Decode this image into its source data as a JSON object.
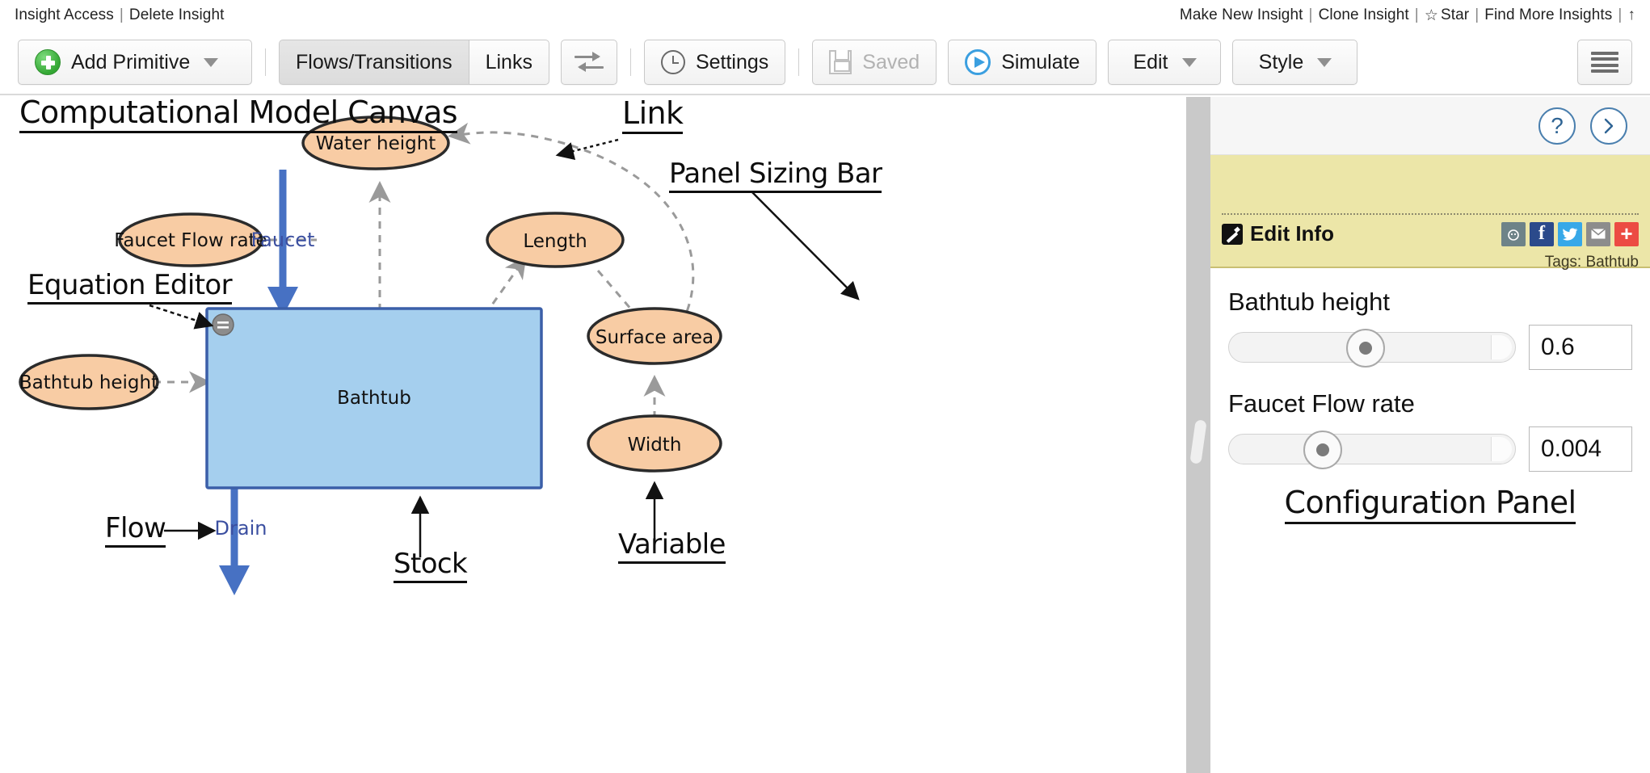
{
  "topbar": {
    "left": [
      {
        "label": "Insight Access"
      },
      {
        "label": "Delete Insight"
      }
    ],
    "right": [
      {
        "label": "Make New Insight"
      },
      {
        "label": "Clone Insight"
      },
      {
        "label": "Star",
        "icon": "star-icon"
      },
      {
        "label": "Find More Insights"
      },
      {
        "label": "↑",
        "icon": "arrow-up-icon"
      }
    ],
    "separator": "|"
  },
  "toolbar": {
    "add_primitive": "Add Primitive",
    "flows_transitions": "Flows/Transitions",
    "links": "Links",
    "swap_icon": "swap-arrows-icon",
    "settings": "Settings",
    "saved": "Saved",
    "simulate": "Simulate",
    "edit": "Edit",
    "style": "Style",
    "menu_icon": "hamburger-menu-icon"
  },
  "canvas": {
    "annotations": [
      {
        "id": "canvas-title",
        "text": "Computational Model Canvas"
      },
      {
        "id": "link-anno",
        "text": "Link"
      },
      {
        "id": "panel-sizing-anno",
        "text": "Panel Sizing Bar"
      },
      {
        "id": "equation-editor-anno",
        "text": "Equation Editor"
      },
      {
        "id": "flow-anno",
        "text": "Flow"
      },
      {
        "id": "stock-anno",
        "text": "Stock"
      },
      {
        "id": "variable-anno",
        "text": "Variable"
      }
    ],
    "nodes": [
      {
        "id": "water-height",
        "label": "Water height",
        "type": "variable"
      },
      {
        "id": "faucet-flow-rate",
        "label": "Faucet Flow rate",
        "type": "variable"
      },
      {
        "id": "bathtub-height",
        "label": "Bathtub height",
        "type": "variable"
      },
      {
        "id": "length",
        "label": "Length",
        "type": "variable"
      },
      {
        "id": "surface-area",
        "label": "Surface area",
        "type": "variable"
      },
      {
        "id": "width",
        "label": "Width",
        "type": "variable"
      },
      {
        "id": "bathtub",
        "label": "Bathtub",
        "type": "stock"
      }
    ],
    "flows": [
      {
        "id": "faucet-flow",
        "label": "Faucet"
      },
      {
        "id": "drain-flow",
        "label": "Drain"
      }
    ],
    "colors": {
      "variable_fill": "#F8CCA4",
      "variable_stroke": "#2b2b2b",
      "stock_fill": "#A5CFEE",
      "stock_stroke": "#3B5FA8",
      "flow_color": "#4771C3",
      "link_color": "#9a9a9a"
    }
  },
  "panel": {
    "help_icon": "question-mark-icon",
    "collapse_icon": "chevron-right-icon",
    "edit_info": "Edit Info",
    "tags": "Tags: Bathtub",
    "social": [
      {
        "name": "reddit-icon",
        "glyph": "◔",
        "color": "#6e8388"
      },
      {
        "name": "facebook-icon",
        "glyph": "f",
        "color": "#2b4a8b"
      },
      {
        "name": "twitter-icon",
        "glyph": "ᴠ",
        "color": "#37a8e8"
      },
      {
        "name": "email-icon",
        "glyph": "✉",
        "color": "#8c8c8c"
      },
      {
        "name": "share-more-icon",
        "glyph": "+",
        "color": "#ec4b43"
      }
    ],
    "sliders": [
      {
        "id": "bathtub-height-slider",
        "label": "Bathtub height",
        "value": "0.6",
        "percent": 47
      },
      {
        "id": "faucet-flow-rate-slider",
        "label": "Faucet Flow rate",
        "value": "0.004",
        "percent": 30
      }
    ],
    "config_label": "Configuration Panel"
  }
}
